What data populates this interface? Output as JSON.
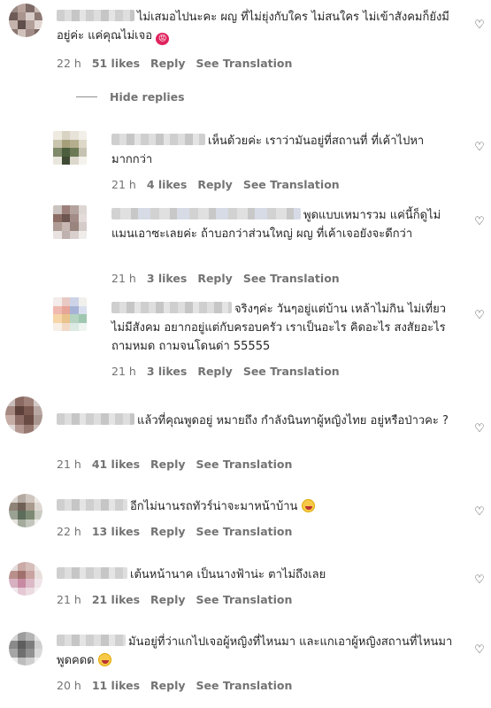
{
  "actions": {
    "reply": "Reply",
    "translate": "See Translation",
    "hide_replies": "Hide replies"
  },
  "comments": [
    {
      "text": "ไม่เสมอไปนะคะ ผญ ที่ไม่ยุ่งกับใคร ไม่สนใคร ไม่เข้าสังคมก็ยังมีอยู่ค่ะ แค่คุณไม่เจอ",
      "time": "22 h",
      "likes": "51 likes"
    },
    {
      "text": "เห็นด้วยค่ะ เราว่ามันอยู่ที่สถานที่ ที่เค้าไปหามากกว่า",
      "time": "21 h",
      "likes": "4 likes"
    },
    {
      "text": "พูดแบบเหมารวม แค่นี้ก็ดูไม่แมนเอาซะเลยค่ะ ถ้าบอกว่าส่วนใหญ่ ผญ ที่เค้าเจอยังจะดีกว่า",
      "time": "21 h",
      "likes": "3 likes"
    },
    {
      "text": "จริงๆค่ะ วันๆอยู่แต่บ้าน เหล้าไม่กิน ไม่เที่ยว ไม่มีสังคม อยากอยู่แต่กับครอบครัว เราเป็นอะไร คิดอะไร สงสัยอะไร ถามหมด ถามจนโดนด่า 55555",
      "time": "21 h",
      "likes": "3 likes"
    },
    {
      "text": "แล้วที่คุณพูดอยู่ หมายถึง กำลังนินทาผู้หญิงไทย อยู่หรือป่าวคะ ?",
      "time": "21 h",
      "likes": "41 likes"
    },
    {
      "text": "อีกไม่นานรถทัวร์น่าจะมาหน้าบ้าน",
      "time": "22 h",
      "likes": "13 likes"
    },
    {
      "text": "เต้นหน้านาค เป็นนางฟ้าน่ะ ตาไม่ถึงเลย",
      "time": "21 h",
      "likes": "21 likes"
    },
    {
      "text": "มันอยู่ที่ว่าแกไปเจอผู้หญิงที่ไหนมา และแกเอาผู้หญิงสถานที่ไหนมาพูดคดด",
      "time": "20 h",
      "likes": "11 likes"
    }
  ]
}
